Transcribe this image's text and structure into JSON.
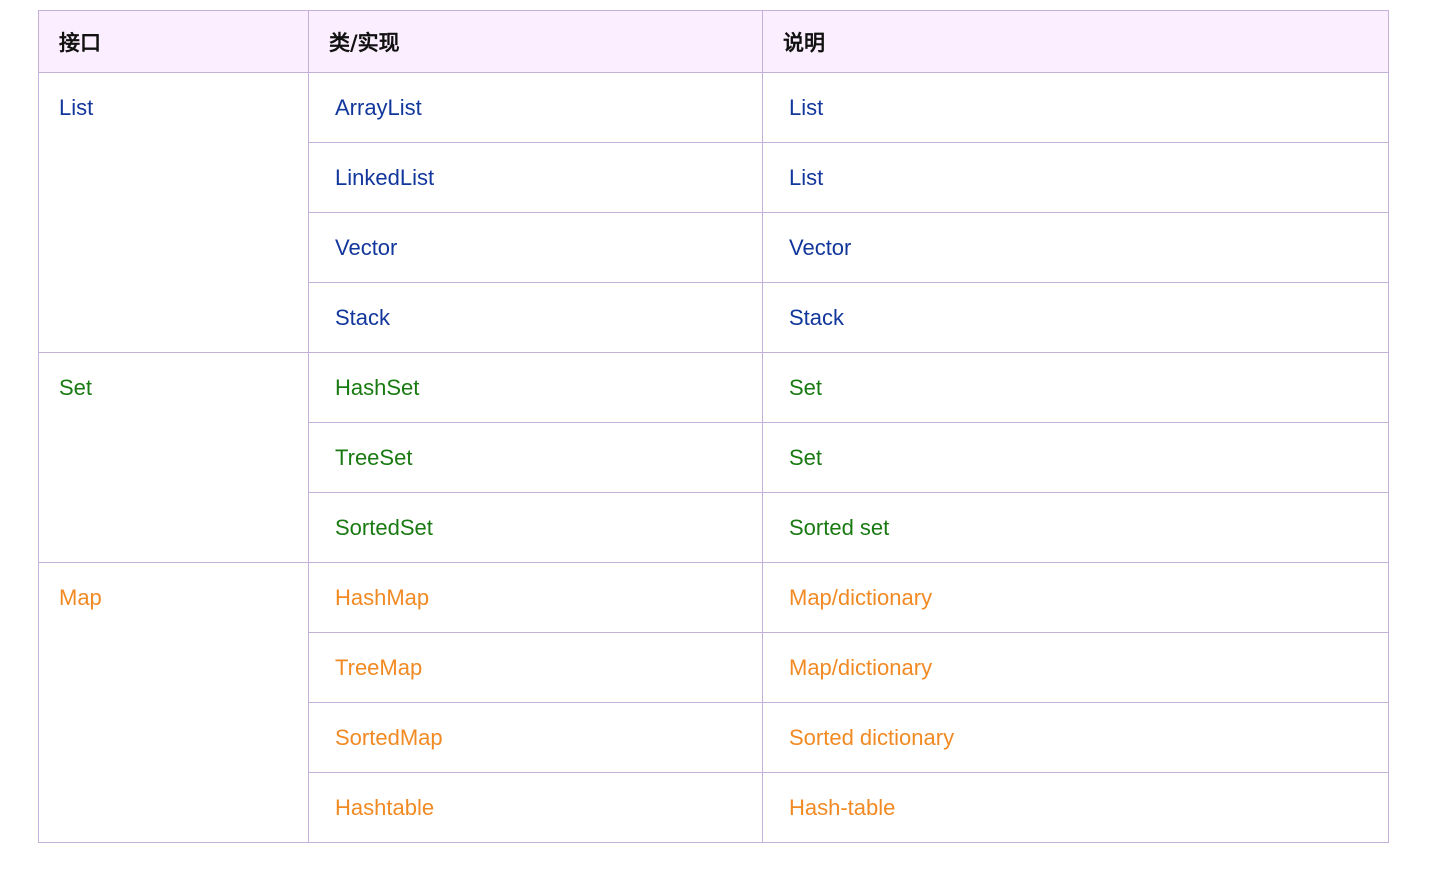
{
  "headers": {
    "interface": "接口",
    "impl": "类/实现",
    "desc": "说明"
  },
  "colors": {
    "list": "#12379c",
    "set": "#1a7a12",
    "map": "#f28a24"
  },
  "groups": [
    {
      "interface": "List",
      "color": "#12379c",
      "rows": [
        {
          "impl": "ArrayList",
          "desc": "List"
        },
        {
          "impl": "LinkedList",
          "desc": "List"
        },
        {
          "impl": "Vector",
          "desc": "Vector"
        },
        {
          "impl": "Stack",
          "desc": "Stack"
        }
      ]
    },
    {
      "interface": "Set",
      "color": "#1a7a12",
      "rows": [
        {
          "impl": "HashSet",
          "desc": "Set"
        },
        {
          "impl": "TreeSet",
          "desc": "Set"
        },
        {
          "impl": "SortedSet",
          "desc": "Sorted set"
        }
      ]
    },
    {
      "interface": "Map",
      "color": "#f28a24",
      "rows": [
        {
          "impl": "HashMap",
          "desc": "Map/dictionary"
        },
        {
          "impl": "TreeMap",
          "desc": "Map/dictionary"
        },
        {
          "impl": "SortedMap",
          "desc": "Sorted dictionary"
        },
        {
          "impl": "Hashtable",
          "desc": "Hash-table"
        }
      ]
    }
  ]
}
